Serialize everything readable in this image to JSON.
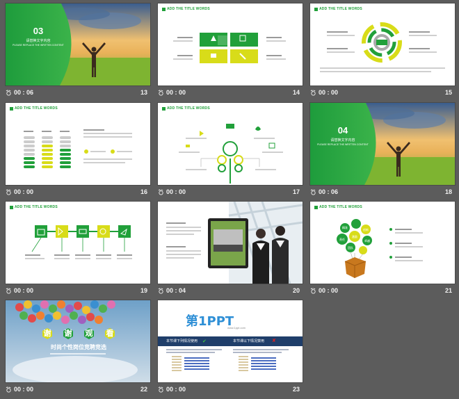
{
  "slides": [
    {
      "number": "13",
      "time": "00 : 06",
      "big": "03",
      "sub": "请替换文字内容",
      "en": "PLEASE REPLACE THE WRITTEN CONTENT"
    },
    {
      "number": "14",
      "time": "00 : 00",
      "header": "ADD THE TITLE WORDS"
    },
    {
      "number": "15",
      "time": "00 : 00",
      "header": "ADD THE TITLE WORDS"
    },
    {
      "number": "16",
      "time": "00 : 00",
      "header": "ADD THE TITLE WORDS"
    },
    {
      "number": "17",
      "time": "00 : 00",
      "header": "ADD THE TITLE WORDS"
    },
    {
      "number": "18",
      "time": "00 : 06",
      "big": "04",
      "sub": "请替换文字内容",
      "en": "PLEASE REPLACE THE WRITTEN CONTENT"
    },
    {
      "number": "19",
      "time": "00 : 00",
      "header": "ADD THE TITLE WORDS"
    },
    {
      "number": "20",
      "time": "00 : 04",
      "header": ""
    },
    {
      "number": "21",
      "time": "00 : 00",
      "header": "ADD THE TITLE WORDS",
      "balloons": [
        "精准",
        "责任",
        "激励",
        "卓越",
        "团队",
        "创新"
      ]
    },
    {
      "number": "22",
      "time": "00 : 00",
      "chars": [
        "谢",
        "谢",
        "观",
        "看"
      ],
      "subtitle": "时尚个性岗位竞聘竞选"
    },
    {
      "number": "23",
      "time": "00 : 00",
      "logo": "第1PPT",
      "logo_sub": "www.1ppt.com",
      "left_title": "本节课下列情况使用",
      "right_title": "本节课以下情况禁用"
    }
  ],
  "colors": {
    "green": "#21a03a",
    "yellow": "#d8dc19",
    "bg": "#5c5c5c"
  }
}
